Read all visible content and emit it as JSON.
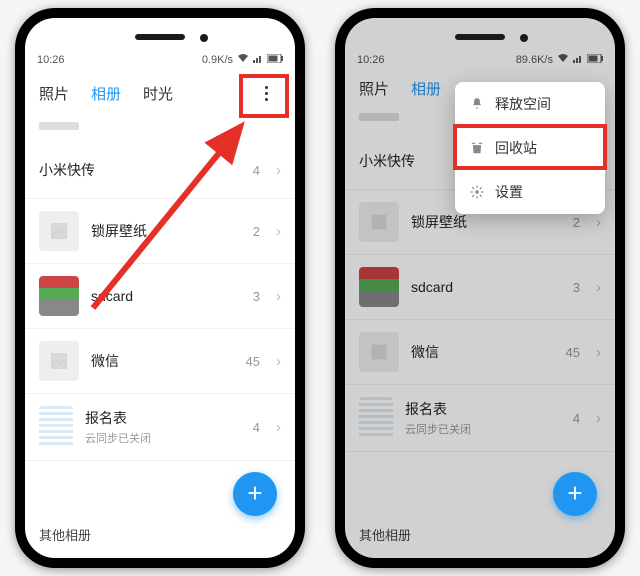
{
  "status": {
    "time": "10:26",
    "net1": "0.9K/s",
    "net2": "89.6K/s"
  },
  "tabs": {
    "photos": "照片",
    "albums": "相册",
    "moments": "时光"
  },
  "items": [
    {
      "title": "小米快传",
      "count": "4",
      "thumb": "none"
    },
    {
      "title": "锁屏壁纸",
      "count": "2",
      "thumb": "placeholder"
    },
    {
      "title": "sdcard",
      "count": "3",
      "thumb": "photo"
    },
    {
      "title": "微信",
      "count": "45",
      "thumb": "placeholder"
    },
    {
      "title": "报名表",
      "sub": "云同步已关闭",
      "count": "4",
      "thumb": "sheet"
    }
  ],
  "bottom_peek": "其他相册",
  "menu": {
    "free": "释放空间",
    "trash": "回收站",
    "settings": "设置"
  },
  "fab": "+"
}
